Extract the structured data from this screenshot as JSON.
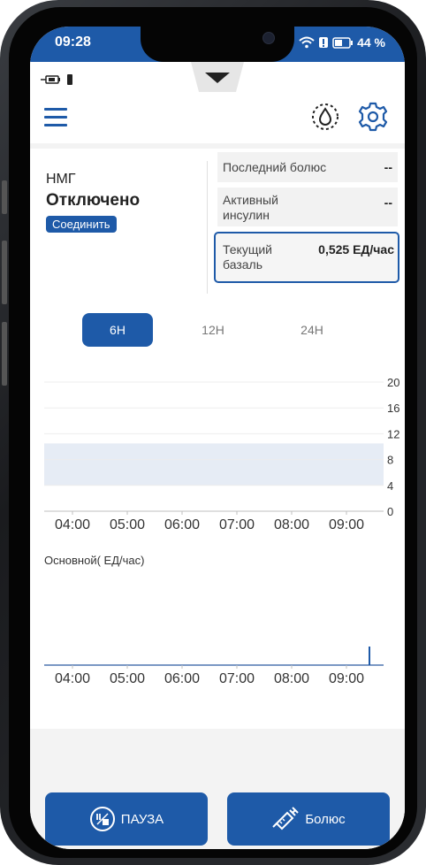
{
  "status_bar": {
    "time": "09:28",
    "battery": "44 %"
  },
  "cgm": {
    "label": "НМГ",
    "status": "Отключено",
    "connect_label": "Соединить"
  },
  "info_cards": {
    "last_bolus_label": "Последний болюс",
    "last_bolus_value": "--",
    "active_insulin_label_1": "Активный",
    "active_insulin_label_2": "инсулин",
    "active_insulin_value": "--",
    "current_basal_label_1": "Текущий",
    "current_basal_label_2": "базаль",
    "current_basal_value": "0,525 ЕД/час"
  },
  "range_tabs": [
    {
      "label": "6Н",
      "active": true
    },
    {
      "label": "12Н",
      "active": false
    },
    {
      "label": "24Н",
      "active": false
    }
  ],
  "chart_data": [
    {
      "type": "area",
      "x_ticks": [
        "04:00",
        "05:00",
        "06:00",
        "07:00",
        "08:00",
        "09:00"
      ],
      "y_ticks": [
        0,
        4,
        8,
        12,
        16,
        20
      ],
      "ylim": [
        0,
        20
      ],
      "target_band": [
        4,
        10.5
      ],
      "series": []
    },
    {
      "type": "line",
      "title": "Основной( ЕД/час)",
      "x_ticks": [
        "04:00",
        "05:00",
        "06:00",
        "07:00",
        "08:00",
        "09:00"
      ],
      "series": [
        {
          "x": [
            "04:00",
            "09:28"
          ],
          "values": [
            0,
            0
          ]
        },
        {
          "x": [
            "09:28"
          ],
          "values": [
            0.525
          ]
        }
      ]
    }
  ],
  "actions": {
    "pause_label": "ПАУЗА",
    "bolus_label": "Болюс"
  },
  "colors": {
    "accent": "#1e5aa8",
    "band": "#e6ecf5"
  }
}
